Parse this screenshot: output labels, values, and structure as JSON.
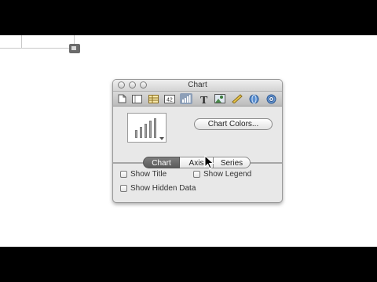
{
  "window": {
    "title": "Chart"
  },
  "toolbar": {
    "icons": [
      "document-icon",
      "layout-icon",
      "table-icon",
      "number-format-icon",
      "chart-icon",
      "text-icon",
      "image-icon",
      "ruler-icon",
      "globe-icon",
      "target-icon"
    ],
    "active": "chart-icon"
  },
  "content": {
    "chart_colors_label": "Chart Colors..."
  },
  "tabs": [
    {
      "label": "Chart",
      "selected": true
    },
    {
      "label": "Axis",
      "selected": false
    },
    {
      "label": "Series",
      "selected": false
    }
  ],
  "options": {
    "show_title": "Show Title",
    "show_legend": "Show Legend",
    "show_hidden_data": "Show Hidden Data"
  },
  "colors": {
    "active_tab": "#6b6b6b",
    "toolbar_active": "#8d9fb8"
  }
}
